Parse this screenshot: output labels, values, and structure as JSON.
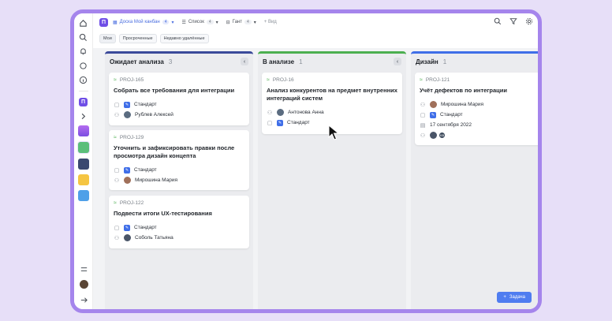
{
  "colors": {
    "accent": "#a585ec",
    "brand": "#6f4ee6",
    "primary": "#4f7df0",
    "priority": "#4caf50"
  },
  "project": {
    "badge": "П"
  },
  "views": [
    {
      "label": "Доска Мой канбан",
      "count": "4",
      "icon": "board-icon",
      "active": true
    },
    {
      "label": "Список",
      "count": "4",
      "icon": "list-icon"
    },
    {
      "label": "Гант",
      "count": "4",
      "icon": "gantt-icon"
    }
  ],
  "add_view": "+ Вид",
  "filters": [
    "Мои",
    "Просроченные",
    "Недавно удалённые"
  ],
  "columns": [
    {
      "title": "Ожидает анализа",
      "count": "3",
      "color": "#3b4a9a",
      "cards": [
        {
          "key": "PROJ-165",
          "title": "Собрать все требования для интеграции",
          "type": "Стандарт",
          "assignee": "Рублев Алексей"
        },
        {
          "key": "PROJ-129",
          "title": "Уточнить и зафиксировать правки после просмотра дизайн концепта",
          "type": "Стандарт",
          "assignee": "Мирошина Мария"
        },
        {
          "key": "PROJ-122",
          "title": "Подвести итоги UX-тестирования",
          "type": "Стандарт",
          "assignee": "Соболь Татьяна"
        }
      ]
    },
    {
      "title": "В анализе",
      "count": "1",
      "color": "#4caf50",
      "cards": [
        {
          "key": "PROJ-16",
          "title": "Анализ конкурентов на предмет внутренних интеграций систем",
          "assignee": "Антонова Анна",
          "type": "Стандарт"
        }
      ]
    },
    {
      "title": "Дизайн",
      "count": "1",
      "color": "#3f6ee8",
      "cards": [
        {
          "key": "PROJ-121",
          "title": "Учёт дефектов по интеграции",
          "assignee": "Мирошина Мария",
          "type": "Стандарт",
          "date": "17 сентября 2022",
          "watchers": [
            "",
            "KB"
          ]
        }
      ]
    }
  ],
  "add_task": "Задача",
  "add_task_icon": "+"
}
